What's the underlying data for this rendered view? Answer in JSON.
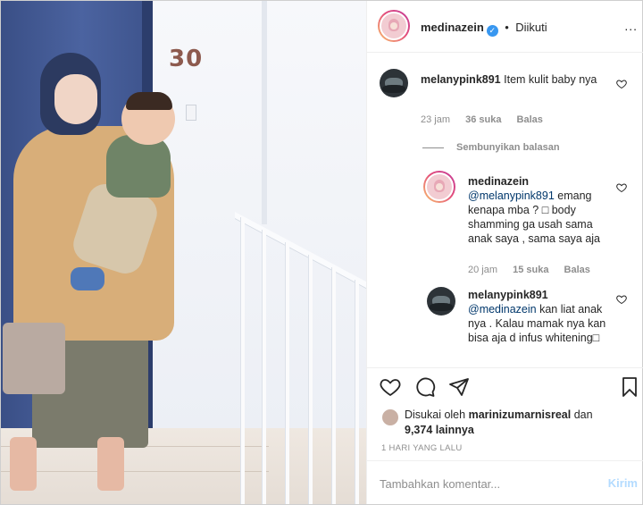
{
  "post": {
    "author": "medinazein",
    "follow_sep": "•",
    "follow_status": "Diikuti",
    "more": "..."
  },
  "comments": [
    {
      "user": "melanypink891",
      "text": "Item kulit baby nya",
      "time": "23 jam",
      "likes": "36 suka",
      "reply": "Balas",
      "hide_replies": "Sembunyikan balasan"
    },
    {
      "user": "medinazein",
      "mention": "@melanypink891",
      "text": "emang kenapa mba ? □ body shamming ga usah sama anak saya , sama saya aja",
      "time": "20 jam",
      "likes": "15 suka",
      "reply": "Balas"
    },
    {
      "user": "melanypink891",
      "mention": "@medinazein",
      "text": "kan liat anak nya . Kalau mamak nya kan bisa aja d infus whitening□"
    }
  ],
  "likes": {
    "prefix": "Disukai oleh",
    "user": "marinizumarnisreal",
    "joiner": "dan",
    "others": "9,374 lainnya"
  },
  "time_ago": "1 HARI YANG LALU",
  "add_comment": {
    "placeholder": "Tambahkan komentar...",
    "post_label": "Kirim"
  },
  "photo": {
    "house_number": "30"
  },
  "icons": {
    "like": "heart-icon",
    "comment": "comment-bubble-icon",
    "share": "paper-plane-icon",
    "save": "bookmark-icon",
    "verified": "verified-badge-icon",
    "more": "more-options-icon"
  }
}
